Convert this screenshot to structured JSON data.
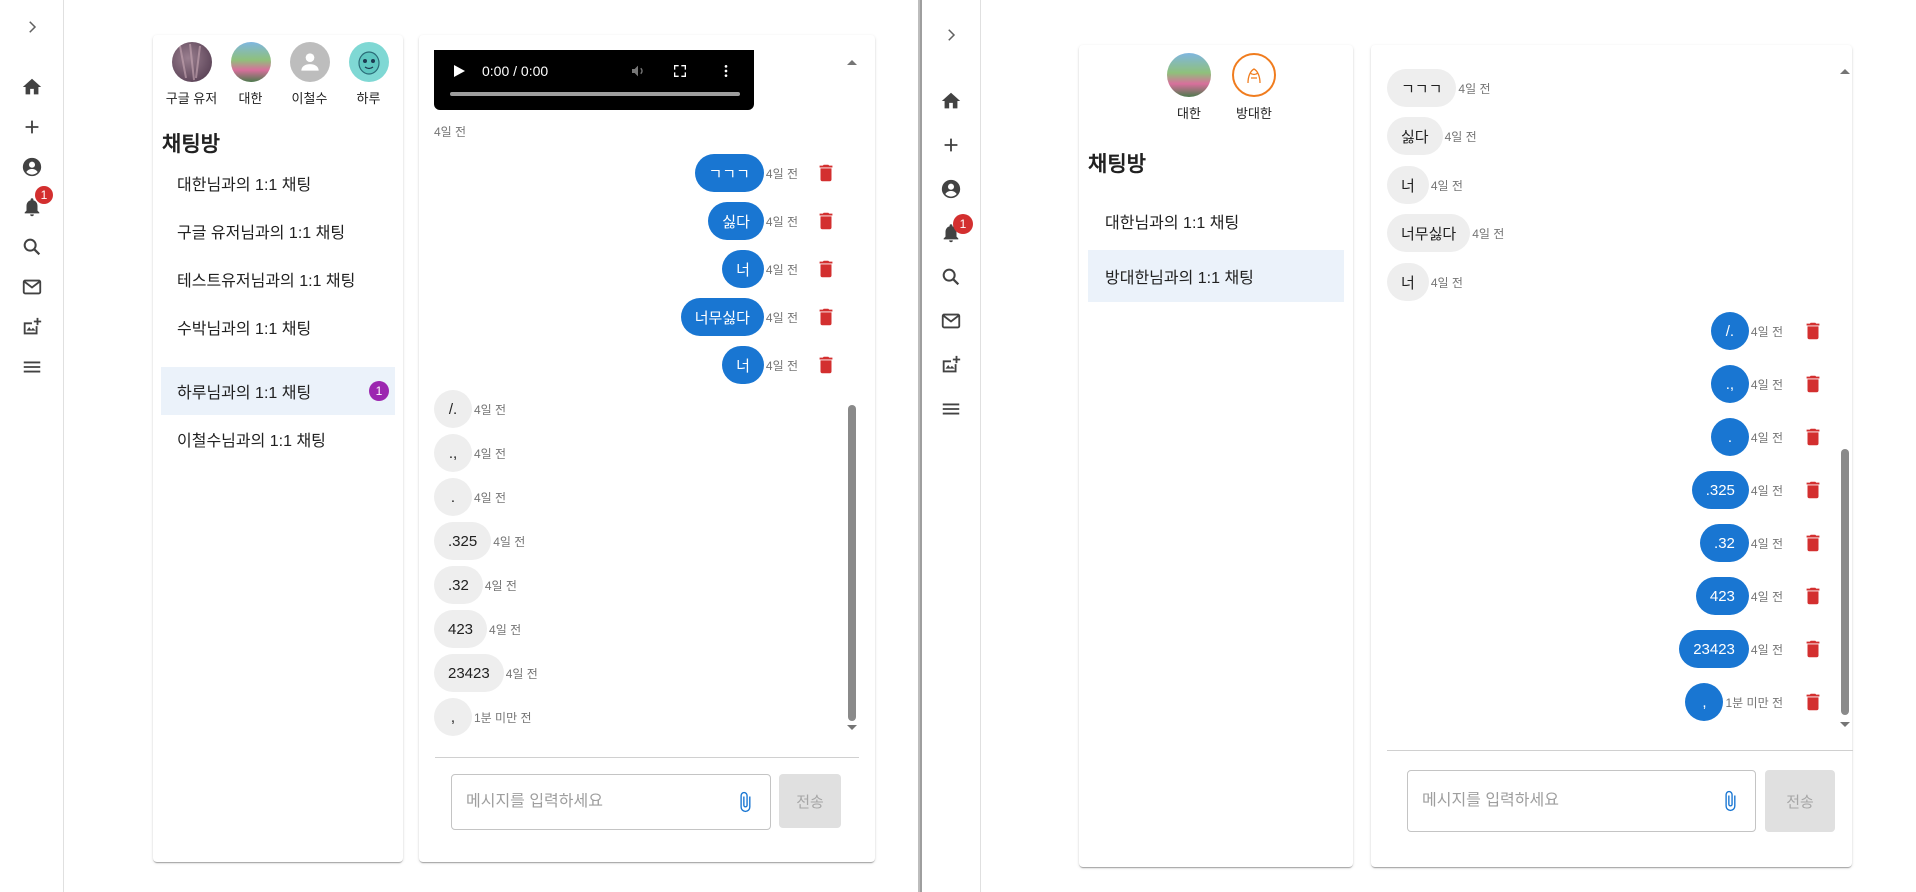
{
  "left_window": {
    "badge_count": "1",
    "users": [
      {
        "name": "구글 유저",
        "avatar": "photo-avatar-purple"
      },
      {
        "name": "대한",
        "avatar": "photo-avatar-landscape"
      },
      {
        "name": "이철수",
        "avatar": "default-person-icon"
      },
      {
        "name": "하루",
        "avatar": "cartoon-avatar-teal"
      }
    ],
    "rooms_title": "채팅방",
    "rooms": [
      {
        "label": "대한님과의 1:1 채팅"
      },
      {
        "label": "구글 유저님과의 1:1 채팅"
      },
      {
        "label": "테스트유저님과의 1:1 채팅"
      },
      {
        "label": "수박님과의 1:1 채팅"
      },
      {
        "label": "하루님과의 1:1 채팅",
        "unread": "1",
        "selected": true
      },
      {
        "label": "이철수님과의 1:1 채팅"
      }
    ],
    "video": {
      "time": "0:00 / 0:00",
      "date": "4일 전"
    },
    "messages": [
      {
        "text": "ㄱㄱㄱ",
        "time": "4일 전",
        "mine": true
      },
      {
        "text": "싫다",
        "time": "4일 전",
        "mine": true
      },
      {
        "text": "너",
        "time": "4일 전",
        "mine": true
      },
      {
        "text": "너무싫다",
        "time": "4일 전",
        "mine": true
      },
      {
        "text": "너",
        "time": "4일 전",
        "mine": true
      },
      {
        "text": "/.",
        "time": "4일 전",
        "mine": false
      },
      {
        "text": ".,",
        "time": "4일 전",
        "mine": false
      },
      {
        "text": ".",
        "time": "4일 전",
        "mine": false
      },
      {
        "text": ".325",
        "time": "4일 전",
        "mine": false
      },
      {
        "text": ".32",
        "time": "4일 전",
        "mine": false
      },
      {
        "text": "423",
        "time": "4일 전",
        "mine": false
      },
      {
        "text": "23423",
        "time": "4일 전",
        "mine": false
      },
      {
        "text": ",",
        "time": "1분 미만 전",
        "mine": false
      }
    ],
    "input_placeholder": "메시지를 입력하세요",
    "send_label": "전송"
  },
  "right_window": {
    "badge_count": "1",
    "users": [
      {
        "name": "대한",
        "avatar": "photo-avatar-landscape"
      },
      {
        "name": "방대한",
        "avatar": "orange-sketch-avatar"
      }
    ],
    "rooms_title": "채팅방",
    "rooms": [
      {
        "label": "대한님과의 1:1 채팅"
      },
      {
        "label": "방대한님과의 1:1 채팅",
        "selected": true
      }
    ],
    "messages": [
      {
        "text": "ㄱㄱㄱ",
        "time": "4일 전",
        "mine": false
      },
      {
        "text": "싫다",
        "time": "4일 전",
        "mine": false
      },
      {
        "text": "너",
        "time": "4일 전",
        "mine": false
      },
      {
        "text": "너무싫다",
        "time": "4일 전",
        "mine": false
      },
      {
        "text": "너",
        "time": "4일 전",
        "mine": false
      },
      {
        "text": "/.",
        "time": "4일 전",
        "mine": true
      },
      {
        "text": ".,",
        "time": "4일 전",
        "mine": true
      },
      {
        "text": ".",
        "time": "4일 전",
        "mine": true
      },
      {
        "text": ".325",
        "time": "4일 전",
        "mine": true
      },
      {
        "text": ".32",
        "time": "4일 전",
        "mine": true
      },
      {
        "text": "423",
        "time": "4일 전",
        "mine": true
      },
      {
        "text": "23423",
        "time": "4일 전",
        "mine": true
      },
      {
        "text": ",",
        "time": "1분 미만 전",
        "mine": true
      }
    ],
    "input_placeholder": "메시지를 입력하세요",
    "send_label": "전송"
  },
  "colors": {
    "primary": "#1976d2",
    "trash": "#d32f2f",
    "badge": "#d32f2f",
    "unread": "#9c27b0",
    "selected_room": "#ebf2fa",
    "other_bubble": "#eeeeee"
  }
}
